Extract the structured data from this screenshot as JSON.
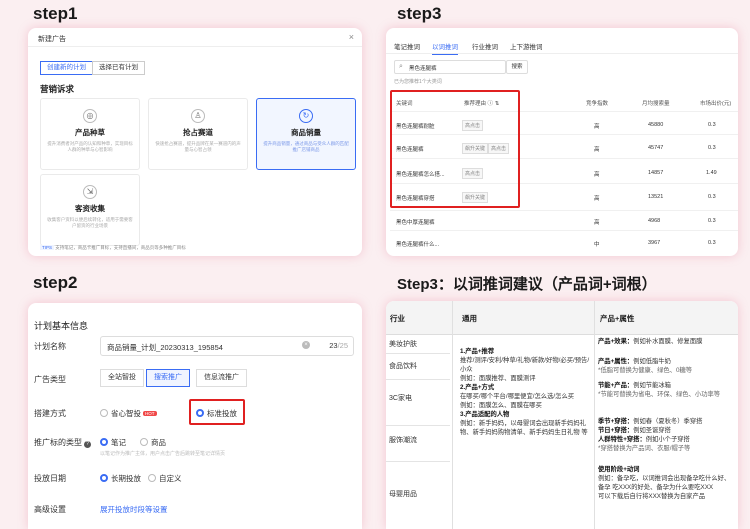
{
  "steps": {
    "s1": "step1",
    "s2": "step2",
    "s3a": "step3",
    "s3b": "Step3：以词推词建议（产品词+词根）"
  },
  "panel1": {
    "header": "新建广告",
    "close": "×",
    "seg": [
      "创建新的计划",
      "选择已有计划"
    ],
    "section": "营销诉求",
    "goals": [
      {
        "title": "产品种草",
        "icon": "lock-icon",
        "desc": "提升消费者对产品的认知和种草，实现目标人群的种草与心智影响"
      },
      {
        "title": "抢占赛道",
        "icon": "user-icon",
        "desc": "快速抢占赛道，提升品牌在某一赛道内的声量与心智占领"
      },
      {
        "title": "商品销量",
        "icon": "refresh-icon",
        "desc": "提升商品销量，通过商品与受众人群的匹配推广店铺商品"
      },
      {
        "title": "客资收集",
        "icon": "collect-icon",
        "desc": "收集客户资料以便后续转化，适用于需要客户留资的行业场景"
      }
    ],
    "tips_tag": "TIPS",
    "tips": "支持笔记，商品卡推广目标，支持直播间，商品页等多种推广目标"
  },
  "panel2": {
    "section": "计划基本信息",
    "labels": {
      "name": "计划名称",
      "type": "广告类型",
      "method": "搭建方式",
      "target": "推广标的类型",
      "date": "投放日期",
      "advanced": "高级设置"
    },
    "name_value": "商品销量_计划_20230313_195854",
    "name_count": "23",
    "name_max": "/25",
    "types": [
      "全站智投",
      "搜索推广",
      "信息流推广"
    ],
    "method_options": [
      "省心智投",
      "标准投放"
    ],
    "hot": "HOT",
    "target_options": [
      "笔记",
      "商品"
    ],
    "target_hint": "以笔记作为推广主体，用户点击广告后跳转至笔记详情页",
    "date_options": [
      "长期投放",
      "自定义"
    ],
    "advanced_link": "展开投放时段等设置"
  },
  "panel3": {
    "tabs": [
      "笔记推词",
      "以词推词",
      "行业推词",
      "上下游推词"
    ],
    "search_value": "黑色连腿裤",
    "search_button": "搜索",
    "result_count": "已为您推荐1个大类词",
    "headers": [
      "关键词",
      "推荐理由",
      "竞争指数",
      "月均搜索量",
      "市场出价(元)"
    ],
    "rows": [
      {
        "kw": "黑色连腿裤耐脏",
        "tags": [
          "高点击"
        ],
        "comp": "高",
        "vol": "45880",
        "bid": "0.3"
      },
      {
        "kw": "黑色连腿裤",
        "tags": [
          "飙升关键",
          "高点击"
        ],
        "comp": "高",
        "vol": "45747",
        "bid": "0.3"
      },
      {
        "kw": "黑色连腿裤怎么搭...",
        "tags": [
          "高点击"
        ],
        "comp": "高",
        "vol": "14857",
        "bid": "1.49"
      },
      {
        "kw": "黑色连腿裤穿搭",
        "tags": [
          "飙升关键"
        ],
        "comp": "高",
        "vol": "13521",
        "bid": "0.3"
      },
      {
        "kw": "黑色中厚连腿裤",
        "tags": [],
        "comp": "高",
        "vol": "4968",
        "bid": "0.3"
      },
      {
        "kw": "黑色连腿裤什么...",
        "tags": [],
        "comp": "中",
        "vol": "3967",
        "bid": "0.3"
      }
    ]
  },
  "panel4": {
    "headers": [
      "行业",
      "通用",
      "产品+属性"
    ],
    "industries": [
      "美妆护肤",
      "食品饮料",
      "3C家电",
      "服饰潮流",
      "母婴用品"
    ],
    "general": [
      {
        "t": "1.产品+推荐",
        "d": "推荐/测评/安利/种草/礼物/新款/好物/必买/预告/小众"
      },
      {
        "t": "",
        "d": "例如：面膜推荐、面膜测评"
      },
      {
        "t": "2.产品+方式",
        "d": "在哪买/哪个平台/哪里便宜/怎么选/怎么买"
      },
      {
        "t": "",
        "d": "例如：面膜怎么、面膜在哪买"
      },
      {
        "t": "3.产品适配的人物",
        "d": "例如：新手妈妈，以母婴词会出现新手妈妈礼物、新手妈妈购物清单、新手妈妈生日礼物 等"
      }
    ],
    "attrs": [
      {
        "t": "产品+效果：",
        "d": "例如补水面膜、修复面膜"
      },
      {
        "t": "产品+属性：",
        "d": "例如低脂牛奶",
        "s": "*低脂可替换为健康、绿色、0糖等"
      },
      {
        "t": "节能+产品：",
        "d": "例如节能冰箱",
        "s": "*节能可替换为省电、环保、绿色、小功率等"
      },
      {
        "t": "季节+穿搭：",
        "d": "例如春（夏秋冬）季穿搭"
      },
      {
        "t": "节日+穿搭：",
        "d": "例如圣诞穿搭"
      },
      {
        "t": "人群特性+穿搭：",
        "d": "例如小个子穿搭",
        "s": "*穿搭替换为产品词、衣服/帽子等"
      },
      {
        "t": "使用阶段+动词",
        "d": "例如：备孕吃，以词推词会出现备孕吃什么好、备孕 吃XXX的好处、备孕为什么要吃XXX",
        "s": "可以下载后自行将XXX替换为自家产品"
      }
    ]
  }
}
